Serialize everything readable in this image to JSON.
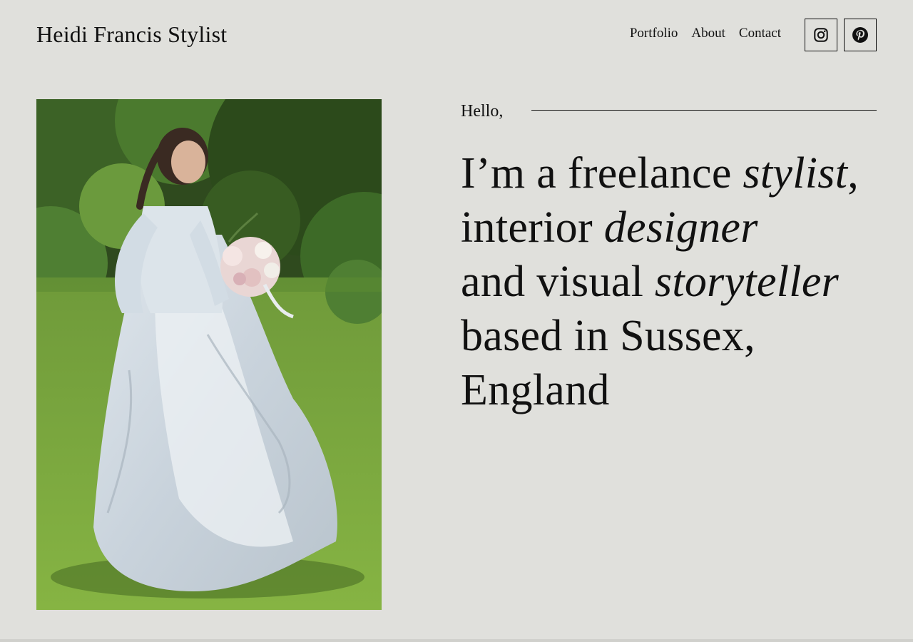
{
  "header": {
    "site_title": "Heidi Francis Stylist",
    "nav": [
      {
        "label": "Portfolio"
      },
      {
        "label": "About"
      },
      {
        "label": "Contact"
      }
    ],
    "social": [
      {
        "icon": "instagram-icon"
      },
      {
        "icon": "pinterest-icon"
      }
    ]
  },
  "intro": {
    "greeting": "Hello,",
    "line1_a": "I’m a freelance ",
    "line1_em": "stylist",
    "line1_b": ",",
    "line2_a": "interior ",
    "line2_em": "designer",
    "line3_a": "and visual ",
    "line3_em": "storyteller",
    "line4": "based in Sussex,",
    "line5": "England"
  },
  "colors": {
    "background": "#e0e0dc",
    "text": "#111111"
  }
}
